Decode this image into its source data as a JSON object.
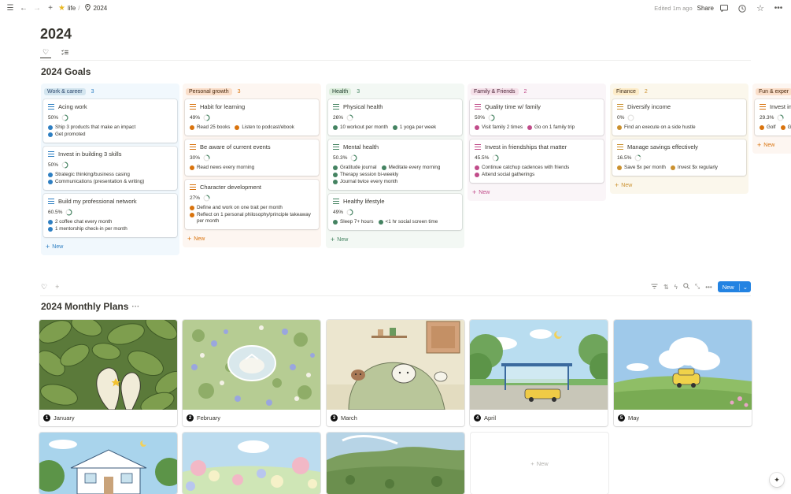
{
  "topbar": {
    "breadcrumb": [
      {
        "icon": "star-icon",
        "label": "life"
      },
      {
        "icon": "pin-icon",
        "label": "2024"
      }
    ],
    "edited": "Edited 1m ago",
    "share": "Share"
  },
  "page": {
    "title": "2024"
  },
  "goals": {
    "title": "2024 Goals",
    "new_label": "New",
    "columns": [
      {
        "name": "Work & career",
        "count": "3",
        "colors": {
          "bg": "#f1f8fd",
          "tag": "#d3e5ef",
          "text": "#28456c",
          "accent": "#2e7fc2"
        },
        "cards": [
          {
            "title": "Acing  work",
            "pct": "50%",
            "progress": 0.5,
            "items": [
              "Ship 3 products that make an impact",
              "Get promoted"
            ]
          },
          {
            "title": "Invest in building 3 skills",
            "pct": "50%",
            "progress": 0.5,
            "items": [
              "Strategic thinking/business casing",
              "Communications (presentation & writing)"
            ]
          },
          {
            "title": "Build my professional network",
            "pct": "60.5%",
            "progress": 0.605,
            "items": [
              "2 coffee chat every month",
              "1 mentorship check-in per month"
            ]
          }
        ]
      },
      {
        "name": "Personal growth",
        "count": "3",
        "colors": {
          "bg": "#fdf6f1",
          "tag": "#fadec9",
          "text": "#49290e",
          "accent": "#d9730d"
        },
        "cards": [
          {
            "title": "Habit for learning",
            "pct": "49%",
            "progress": 0.49,
            "items": [
              "Read 25 books",
              "Listen to podcast/ebook"
            ]
          },
          {
            "title": "Be aware of current events",
            "pct": "30%",
            "progress": 0.3,
            "items": [
              "Read news every morning"
            ]
          },
          {
            "title": "Character development",
            "pct": "27%",
            "progress": 0.27,
            "items": [
              "Define and work on one trait per month",
              "Reflect on 1 personal philosophy/principle takeaway per month"
            ]
          }
        ]
      },
      {
        "name": "Health",
        "count": "3",
        "colors": {
          "bg": "#f3f8f4",
          "tag": "#dbeddb",
          "text": "#1c3829",
          "accent": "#448361"
        },
        "cards": [
          {
            "title": "Physical health",
            "pct": "26%",
            "progress": 0.26,
            "items": [
              "10 workout per month",
              "1 yoga per week"
            ]
          },
          {
            "title": "Mental health",
            "pct": "50.3%",
            "progress": 0.503,
            "items": [
              "Gratitude journal",
              "Meditate every morning",
              "Therapy session bi-weekly",
              "Journal twice every month"
            ]
          },
          {
            "title": "Healthy lifestyle",
            "pct": "49%",
            "progress": 0.49,
            "items": [
              "Sleep 7+ hours",
              "<1 hr social screen time"
            ]
          }
        ]
      },
      {
        "name": "Family & Friends",
        "count": "2",
        "colors": {
          "bg": "#faf5f8",
          "tag": "#f5e0e9",
          "text": "#4c2337",
          "accent": "#c14c8a"
        },
        "cards": [
          {
            "title": "Quality time w/ family",
            "pct": "50%",
            "progress": 0.5,
            "items": [
              "Visit family 2 times",
              "Go on 1 family trip"
            ]
          },
          {
            "title": "Invest in friendships that matter",
            "pct": "45.5%",
            "progress": 0.455,
            "items": [
              "Continue catchup cadences with friends",
              "Attend social gatherings"
            ]
          }
        ]
      },
      {
        "name": "Finance",
        "count": "2",
        "colors": {
          "bg": "#fbf7ec",
          "tag": "#fdecc8",
          "text": "#402c1b",
          "accent": "#cb912f"
        },
        "cards": [
          {
            "title": "Diversify income",
            "pct": "0%",
            "progress": 0,
            "items": [
              "Find an execute on a side hustle"
            ]
          },
          {
            "title": "Manage savings effectively",
            "pct": "16.5%",
            "progress": 0.165,
            "items": [
              "Save $x per month",
              "Invest $x regularly"
            ]
          }
        ]
      },
      {
        "name": "Fun & exper",
        "count": "",
        "colors": {
          "bg": "#fdf6f1",
          "tag": "#fadec9",
          "text": "#49290e",
          "accent": "#d9730d"
        },
        "cards": [
          {
            "title": "Invest in",
            "pct": "29.3%",
            "progress": 0.293,
            "items": [
              "Golf",
              "G"
            ]
          }
        ]
      }
    ]
  },
  "plans": {
    "title": "2024 Monthly Plans",
    "new_button": "New",
    "new_card_label": "New",
    "months": [
      {
        "num": "1",
        "name": "January"
      },
      {
        "num": "2",
        "name": "February"
      },
      {
        "num": "3",
        "name": "March"
      },
      {
        "num": "4",
        "name": "April"
      },
      {
        "num": "5",
        "name": "May"
      }
    ]
  }
}
